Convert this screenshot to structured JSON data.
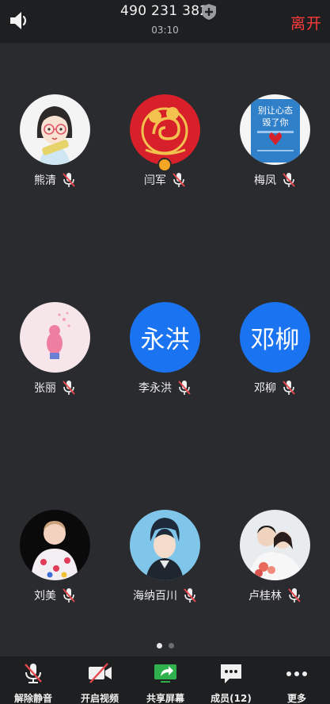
{
  "header": {
    "meeting_id": "490 231 382",
    "timer": "03:10",
    "leave_label": "离开"
  },
  "participants": [
    {
      "name": "熊清",
      "avatar_type": "cartoon-girl-glasses"
    },
    {
      "name": "闫军",
      "avatar_type": "red-gold-rat-emblem",
      "host": true
    },
    {
      "name": "梅凤",
      "avatar_type": "book-cover"
    },
    {
      "name": "张丽",
      "avatar_type": "pink-illustration"
    },
    {
      "name": "李永洪",
      "avatar_text": "永洪"
    },
    {
      "name": "邓柳",
      "avatar_text": "邓柳"
    },
    {
      "name": "刘美",
      "avatar_type": "doll-photo"
    },
    {
      "name": "海纳百川",
      "avatar_type": "anime-man"
    },
    {
      "name": "卢桂林",
      "avatar_type": "couple-photo"
    }
  ],
  "book_cover_text": {
    "line1": "别让心态",
    "line2": "毁了你"
  },
  "pagination": {
    "total": 2,
    "current": 1
  },
  "toolbar": {
    "unmute": "解除静音",
    "start_video": "开启视频",
    "share_screen": "共享屏幕",
    "members": "成员(12)",
    "more": "更多"
  },
  "colors": {
    "accent_blue": "#1a73f0",
    "leave_red": "#ff3b3b",
    "share_green": "#2fb24d",
    "muted_red": "#e5484d"
  }
}
